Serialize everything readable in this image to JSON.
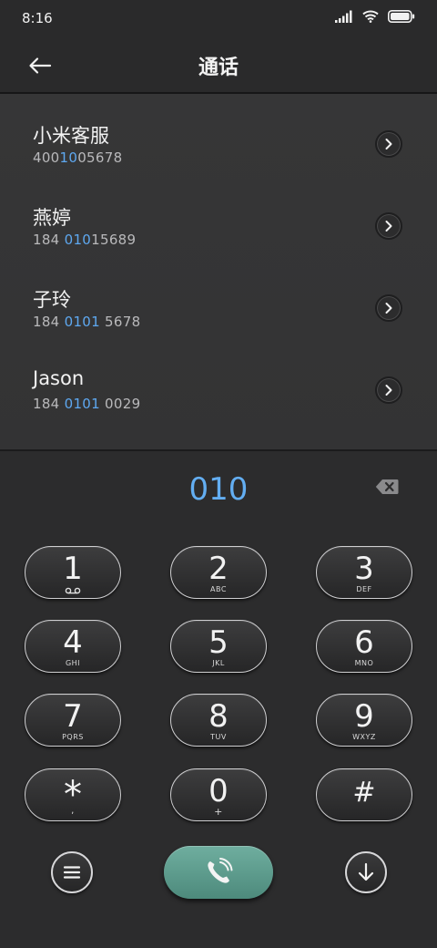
{
  "status_bar": {
    "time": "8:16"
  },
  "header": {
    "title": "通话"
  },
  "contacts": [
    {
      "name": "小米客服",
      "number_pre": "400",
      "number_match": "10",
      "number_post": "05678"
    },
    {
      "name": "燕婷",
      "number_pre": "184 ",
      "number_match": "010",
      "number_post": "15689"
    },
    {
      "name": "子玲",
      "number_pre": "184 ",
      "number_match": "0101",
      "number_post": " 5678"
    },
    {
      "name": "Jason",
      "number_pre": "184 ",
      "number_match": "0101",
      "number_post": " 0029"
    }
  ],
  "dialpad": {
    "input": "010",
    "keys": [
      {
        "digit": "1",
        "letters": ""
      },
      {
        "digit": "2",
        "letters": "ABC"
      },
      {
        "digit": "3",
        "letters": "DEF"
      },
      {
        "digit": "4",
        "letters": "GHI"
      },
      {
        "digit": "5",
        "letters": "JKL"
      },
      {
        "digit": "6",
        "letters": "MNO"
      },
      {
        "digit": "7",
        "letters": "PQRS"
      },
      {
        "digit": "8",
        "letters": "TUV"
      },
      {
        "digit": "9",
        "letters": "WXYZ"
      },
      {
        "digit": "*",
        "letters": ","
      },
      {
        "digit": "0",
        "letters": "+"
      },
      {
        "digit": "#",
        "letters": ""
      }
    ]
  },
  "colors": {
    "accent": "#5ea8f0",
    "call": "#5e9d8e",
    "background": "#2c2c2d"
  },
  "icons": {
    "back": "arrow-left-icon",
    "arrow": "chevron-right-icon",
    "backspace": "backspace-icon",
    "voicemail": "voicemail-icon",
    "menu": "menu-icon",
    "call": "phone-icon",
    "collapse": "arrow-down-icon"
  }
}
